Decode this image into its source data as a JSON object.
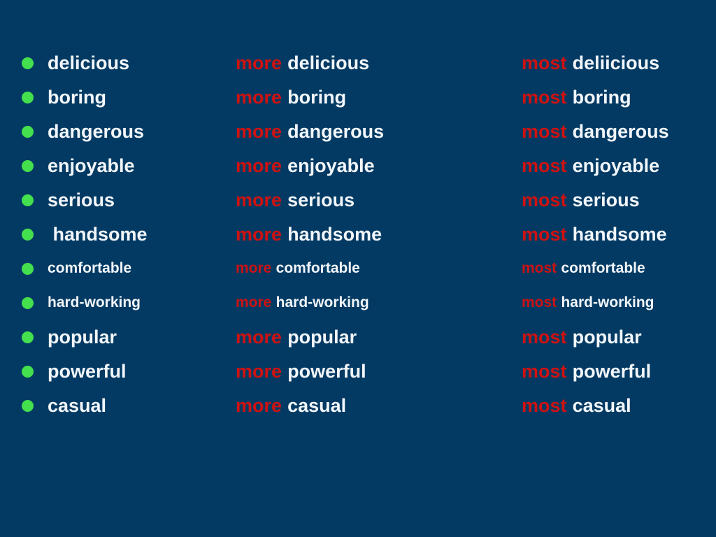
{
  "slide": {
    "background_color": "#023A63",
    "bullet_color": "#44E04D",
    "word_color": "#F2F6FA",
    "degree_color": "#CE1212",
    "comparative_label": "more",
    "superlative_label": "most",
    "rows": [
      {
        "bullet": "green-bullet",
        "base": "delicious",
        "comparative_prefix": "more",
        "comparative_word": "delicious",
        "superlative_prefix": "most",
        "superlative_word": "deliicious",
        "size": "big"
      },
      {
        "bullet": "green-bullet",
        "base": "boring",
        "comparative_prefix": "more",
        "comparative_word": "boring",
        "superlative_prefix": "most",
        "superlative_word": "boring",
        "size": "big"
      },
      {
        "bullet": "green-bullet",
        "base": "dangerous",
        "comparative_prefix": "more",
        "comparative_word": "dangerous",
        "superlative_prefix": "most",
        "superlative_word": "dangerous",
        "size": "big"
      },
      {
        "bullet": "green-bullet",
        "base": "enjoyable",
        "comparative_prefix": "more",
        "comparative_word": "enjoyable",
        "superlative_prefix": "most",
        "superlative_word": "enjoyable",
        "size": "big"
      },
      {
        "bullet": "green-bullet",
        "base": "serious",
        "comparative_prefix": "more",
        "comparative_word": "serious",
        "superlative_prefix": "most",
        "superlative_word": "serious",
        "size": "big"
      },
      {
        "bullet": "green-bullet",
        "base": " handsome",
        "comparative_prefix": "more",
        "comparative_word": "handsome",
        "superlative_prefix": "most",
        "superlative_word": "handsome",
        "size": "big"
      },
      {
        "bullet": "green-bullet",
        "base": "comfortable",
        "comparative_prefix": "more",
        "comparative_word": "comfortable",
        "superlative_prefix": "most",
        "superlative_word": "comfortable",
        "size": "small"
      },
      {
        "bullet": "green-bullet",
        "base": "hard-working",
        "comparative_prefix": "more",
        "comparative_word": "hard-working",
        "superlative_prefix": "most",
        "superlative_word": "hard-working",
        "size": "small"
      },
      {
        "bullet": "green-bullet",
        "base": "popular",
        "comparative_prefix": "more",
        "comparative_word": "popular",
        "superlative_prefix": "most",
        "superlative_word": "popular",
        "size": "big"
      },
      {
        "bullet": "green-bullet",
        "base": "powerful",
        "comparative_prefix": "more",
        "comparative_word": "powerful",
        "superlative_prefix": "most",
        "superlative_word": "powerful",
        "size": "big"
      },
      {
        "bullet": "green-bullet",
        "base": "casual",
        "comparative_prefix": "more",
        "comparative_word": "casual",
        "superlative_prefix": "most",
        "superlative_word": "casual",
        "size": "big"
      }
    ]
  }
}
